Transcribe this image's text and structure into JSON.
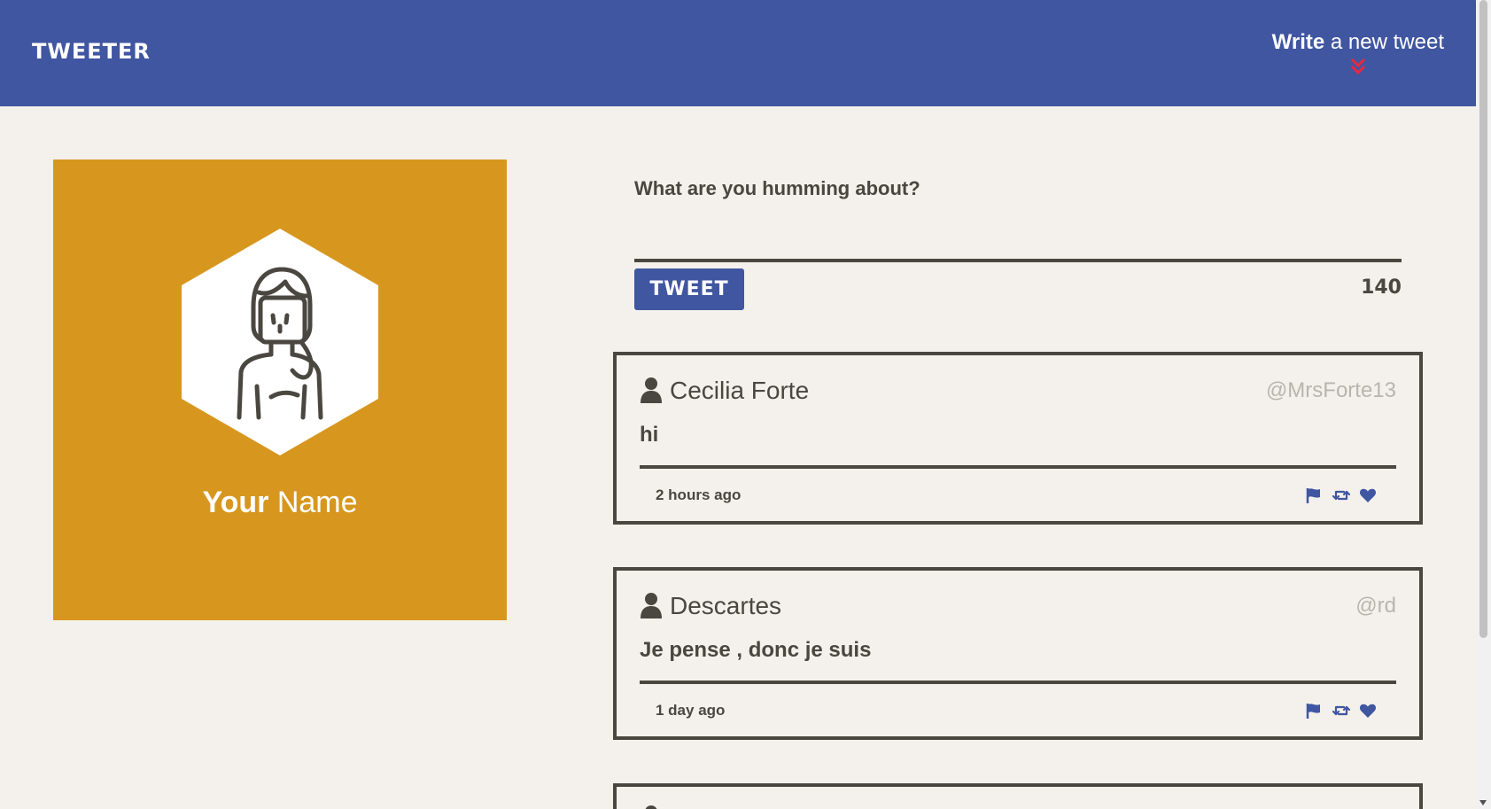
{
  "nav": {
    "brand": "TWEETER",
    "compose_bold": "Write",
    "compose_rest": " a new tweet",
    "brand_color": "#4056a1",
    "accent_color": "#e8283f"
  },
  "profile": {
    "first_name": "Your",
    "last_name": " Name",
    "bg_color": "#d7971f"
  },
  "composer": {
    "prompt": "What are you humming about?",
    "button_label": "TWEET",
    "counter": "140",
    "text_value": ""
  },
  "tweets": [
    {
      "name": "Cecilia Forte",
      "handle": "@MrsForte13",
      "body": "hi",
      "time": "2 hours ago",
      "icons": [
        "flag-icon",
        "retweet-icon",
        "heart-icon"
      ]
    },
    {
      "name": "Descartes",
      "handle": "@rd",
      "body": "Je pense , donc je suis",
      "time": "1 day ago",
      "icons": [
        "flag-icon",
        "retweet-icon",
        "heart-icon"
      ]
    },
    {
      "name": "",
      "handle": "",
      "body": "",
      "time": "",
      "icons": []
    }
  ]
}
